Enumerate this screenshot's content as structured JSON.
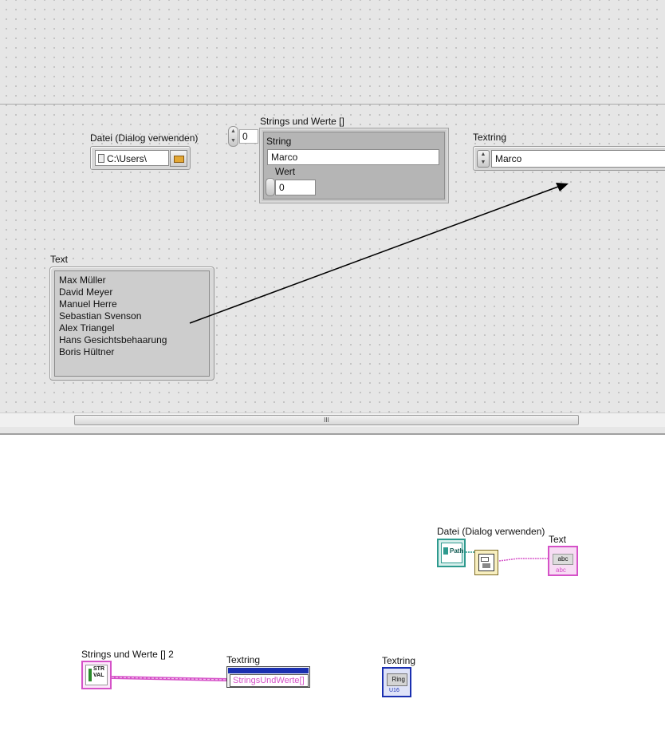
{
  "front_panel": {
    "path_control": {
      "label": "Datei (Dialog verwenden)",
      "value": "C:\\Users\\"
    },
    "array": {
      "label": "Strings und Werte []",
      "index": "0"
    },
    "cluster": {
      "string_label": "String",
      "string_value": "Marco",
      "number_label": "Wert",
      "number_value": "0"
    },
    "ring": {
      "label": "Textring",
      "value": "Marco"
    },
    "text": {
      "label": "Text",
      "lines": [
        "Max Müller",
        "David Meyer",
        "Manuel Herre",
        "Sebastian Svenson",
        "Alex Triangel",
        "Hans Gesichtsbehaarung",
        "Boris Hültner"
      ]
    },
    "scrollbar": {
      "grip": "III"
    }
  },
  "block_diagram": {
    "path_terminal": {
      "label": "Datei (Dialog verwenden)",
      "glyph": "Path"
    },
    "text_indicator": {
      "label": "Text",
      "glyph": "abc",
      "type": "abc"
    },
    "array_terminal": {
      "label": "Strings und Werte [] 2",
      "glyph_top": "STR",
      "glyph_bottom": "VAL"
    },
    "property_node": {
      "label": "Textring",
      "property": "StringsUndWerte[]"
    },
    "ring_terminal": {
      "label": "Textring",
      "glyph": "Ring",
      "type": "U16"
    }
  },
  "colors": {
    "path_wire": "#2e9a8e",
    "string_wire": "#d552c8",
    "cluster_wire": "#d552c8",
    "ring_blue": "#1a2fb0"
  }
}
